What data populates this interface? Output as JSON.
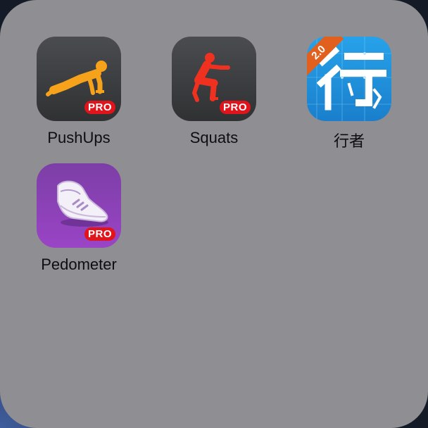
{
  "folder": {
    "apps": [
      {
        "name": "PushUps",
        "badge": "PRO",
        "icon": "pushup-figure-icon"
      },
      {
        "name": "Squats",
        "badge": "PRO",
        "icon": "squat-figure-icon"
      },
      {
        "name": "行者",
        "badge": "2.0",
        "icon": "xing-character-icon"
      },
      {
        "name": "Pedometer",
        "badge": "PRO",
        "icon": "sneaker-icon"
      }
    ]
  },
  "colors": {
    "folder_background": "#8f8e93",
    "pro_badge": "#e1141c",
    "pushups_figure": "#f7a21b",
    "squats_figure": "#f0311f",
    "xingzhe_background": "#1e90d8",
    "version_ribbon": "#e2601d",
    "pedometer_background": "#8a3fb8"
  }
}
